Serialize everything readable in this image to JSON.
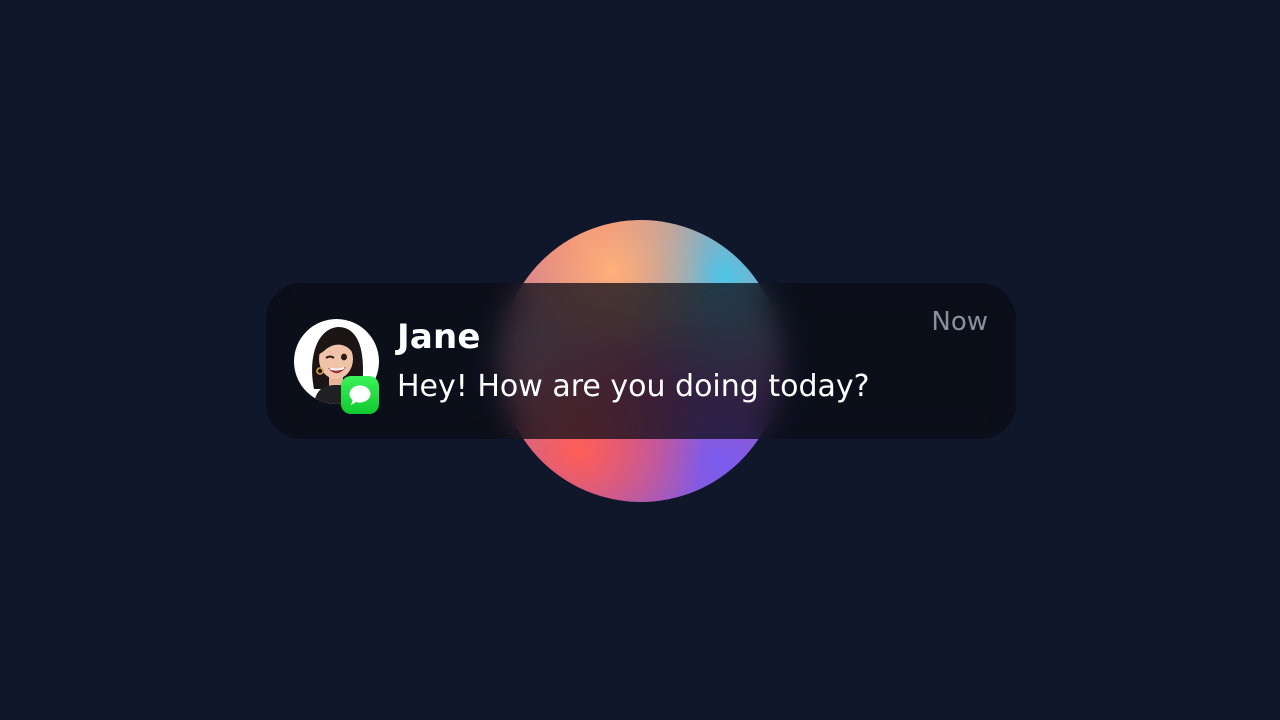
{
  "notification": {
    "sender": "Jane",
    "message": "Hey! How are you doing today?",
    "time": "Now",
    "app_icon": "messages-icon",
    "avatar_icon": "memoji-avatar"
  },
  "colors": {
    "background": "#10172a",
    "card": "#0a0d18",
    "time_text": "#8a8f9e",
    "app_badge": "#1fd63d"
  }
}
